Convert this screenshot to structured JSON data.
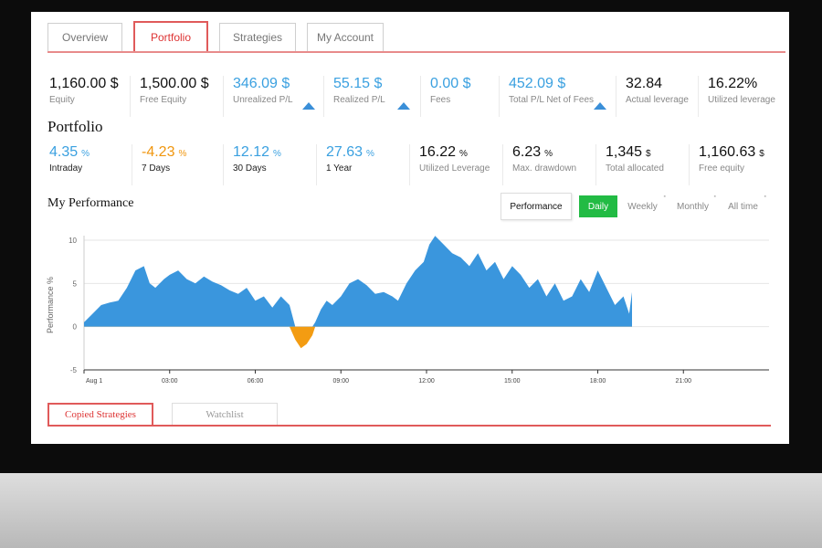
{
  "tabs": [
    {
      "label": "Overview",
      "active": false
    },
    {
      "label": "Portfolio",
      "active": true
    },
    {
      "label": "Strategies",
      "active": false
    },
    {
      "label": "My Account",
      "active": false
    }
  ],
  "stats": [
    {
      "value": "1,160.00 $",
      "label": "Equity",
      "color": "dark",
      "arrow": false
    },
    {
      "value": "1,500.00 $",
      "label": "Free Equity",
      "color": "dark",
      "arrow": false
    },
    {
      "value": "346.09 $",
      "label": "Unrealized P/L",
      "color": "blue",
      "arrow": true
    },
    {
      "value": "55.15 $",
      "label": "Realized P/L",
      "color": "blue",
      "arrow": true
    },
    {
      "value": "0.00 $",
      "label": "Fees",
      "color": "blue",
      "arrow": false
    },
    {
      "value": "452.09 $",
      "label": "Total P/L Net of Fees",
      "color": "blue",
      "arrow": true
    },
    {
      "value": "32.84",
      "label": "Actual leverage",
      "color": "dark",
      "arrow": false
    },
    {
      "value": "16.22%",
      "label": "Utilized leverage",
      "color": "dark",
      "arrow": false
    }
  ],
  "portfolio": {
    "title": "Portfolio",
    "items": [
      {
        "value": "4.35",
        "unit": "%",
        "label": "Intraday",
        "color": "blue"
      },
      {
        "value": "-4.23",
        "unit": "%",
        "label": "7 Days",
        "color": "orange"
      },
      {
        "value": "12.12",
        "unit": "%",
        "label": "30 Days",
        "color": "blue"
      },
      {
        "value": "27.63",
        "unit": "%",
        "label": "1 Year",
        "color": "blue"
      },
      {
        "value": "16.22",
        "unit": "%",
        "label": "Utilized Leverage",
        "color": "dark"
      },
      {
        "value": "6.23",
        "unit": "%",
        "label": "Max. drawdown",
        "color": "dark"
      },
      {
        "value": "1,345",
        "unit": "$",
        "label": "Total allocated",
        "color": "dark"
      },
      {
        "value": "1,160.63",
        "unit": "$",
        "label": "Free equity",
        "color": "dark"
      }
    ]
  },
  "performance": {
    "title": "My Performance",
    "label_button": "Performance",
    "ranges": [
      {
        "label": "Daily",
        "active": true
      },
      {
        "label": "Weekly",
        "active": false
      },
      {
        "label": "Monthly",
        "active": false
      },
      {
        "label": "All time",
        "active": false
      }
    ]
  },
  "chart_data": {
    "type": "area",
    "ylabel": "Performance %",
    "xlabel": "",
    "ylim": [
      -5,
      10
    ],
    "yticks": [
      10,
      5,
      0,
      -5
    ],
    "xlim_hours": [
      0,
      24
    ],
    "xticks": [
      {
        "hour": 0,
        "label": "Aug 1"
      },
      {
        "hour": 3,
        "label": "03:00"
      },
      {
        "hour": 6,
        "label": "06:00"
      },
      {
        "hour": 9,
        "label": "09:00"
      },
      {
        "hour": 12,
        "label": "12:00"
      },
      {
        "hour": 15,
        "label": "15:00"
      },
      {
        "hour": 18,
        "label": "18:00"
      },
      {
        "hour": 21,
        "label": "21:00"
      }
    ],
    "grid": true,
    "positive_color": "#3a96dd",
    "negative_color": "#f39c12",
    "series": [
      {
        "hours": [
          0.0,
          0.3,
          0.6,
          0.9,
          1.2,
          1.5,
          1.8,
          2.1,
          2.3,
          2.5,
          2.8,
          3.0,
          3.3,
          3.6,
          3.9,
          4.2,
          4.5,
          4.8,
          5.1,
          5.4,
          5.7,
          6.0,
          6.3,
          6.6,
          6.9,
          7.2,
          7.4,
          7.6,
          7.8,
          8.0,
          8.1,
          8.3,
          8.5,
          8.7,
          9.0,
          9.3,
          9.6,
          9.9,
          10.2,
          10.5,
          10.8,
          11.0,
          11.3,
          11.6,
          11.9,
          12.1,
          12.3,
          12.6,
          12.9,
          13.2,
          13.5,
          13.8,
          14.1,
          14.4,
          14.7,
          15.0,
          15.3,
          15.6,
          15.9,
          16.2,
          16.5,
          16.8,
          17.1,
          17.4,
          17.7,
          18.0,
          18.3,
          18.6,
          18.9,
          19.1,
          19.2
        ],
        "values": [
          0.5,
          1.5,
          2.5,
          2.8,
          3.0,
          4.5,
          6.5,
          7.0,
          5.0,
          4.5,
          5.5,
          6.0,
          6.5,
          5.5,
          5.0,
          5.8,
          5.2,
          4.8,
          4.2,
          3.8,
          4.5,
          3.0,
          3.5,
          2.2,
          3.5,
          2.5,
          -1.5,
          -2.5,
          -2.0,
          -1.0,
          0.5,
          2.0,
          3.0,
          2.5,
          3.5,
          5.0,
          5.5,
          4.8,
          3.8,
          4.0,
          3.5,
          3.0,
          5.0,
          6.5,
          7.5,
          9.5,
          10.5,
          9.5,
          8.5,
          8.0,
          7.0,
          8.5,
          6.5,
          7.5,
          5.5,
          7.0,
          6.0,
          4.5,
          5.5,
          3.5,
          5.0,
          3.0,
          3.5,
          5.5,
          4.0,
          6.5,
          4.5,
          2.5,
          3.5,
          1.5,
          4.0
        ]
      }
    ]
  },
  "bottom_tabs": [
    {
      "label": "Copied Strategies",
      "active": true
    },
    {
      "label": "Watchlist",
      "active": false
    }
  ]
}
